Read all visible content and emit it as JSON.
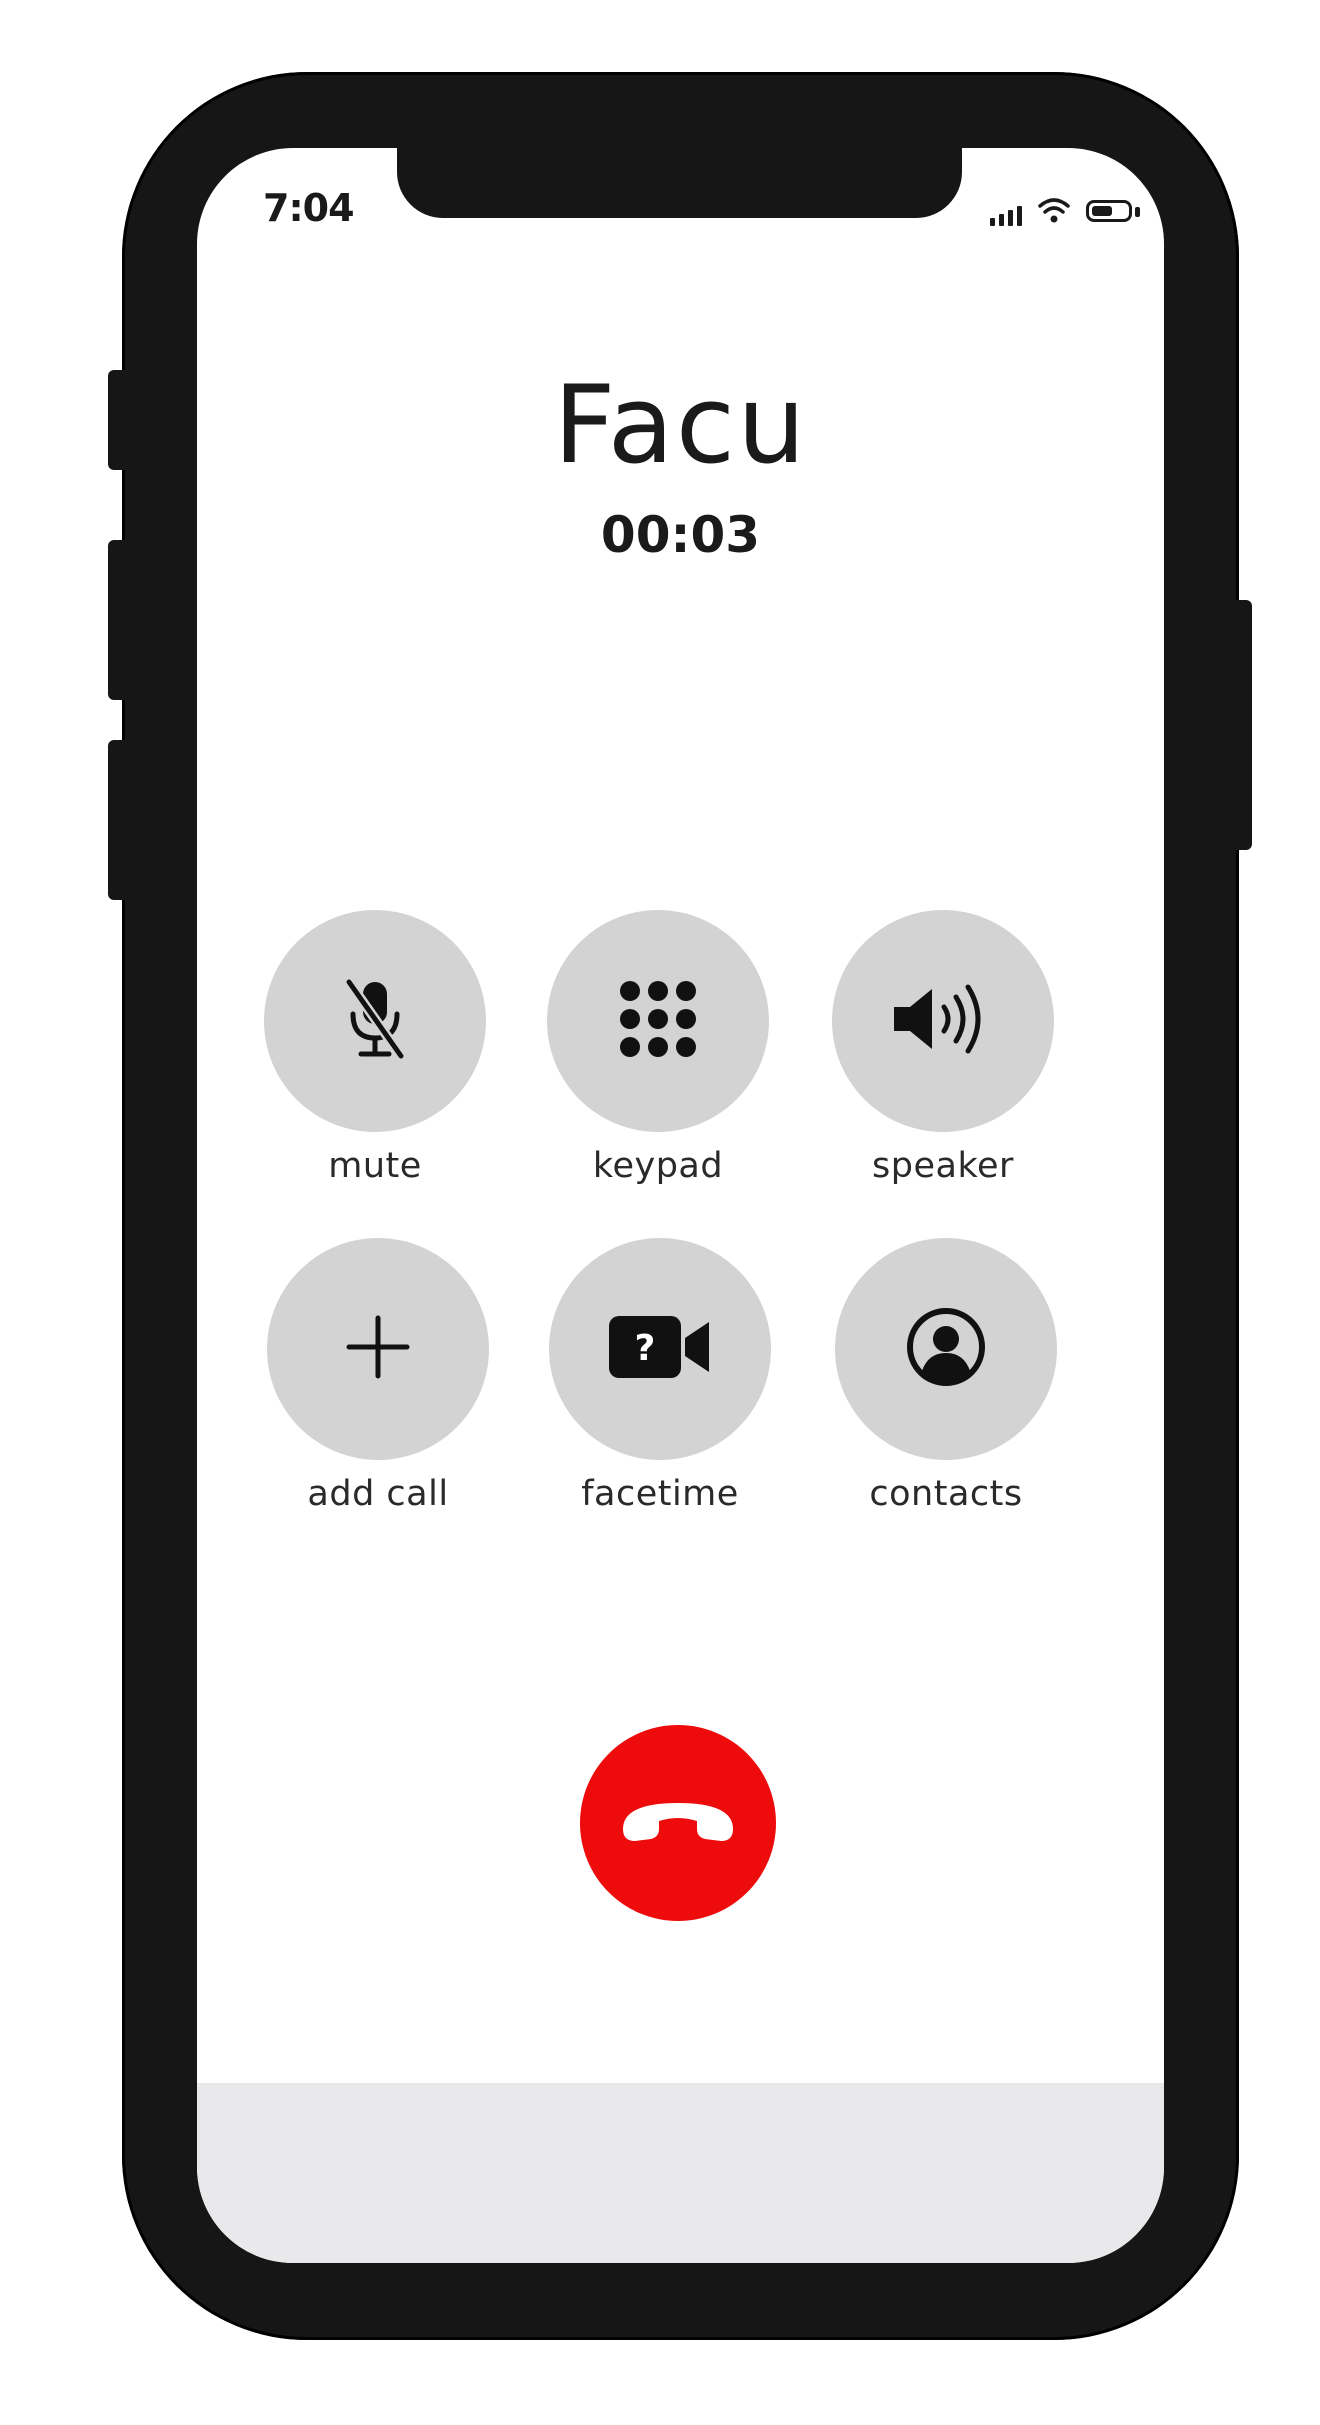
{
  "status_bar": {
    "time": "7:04",
    "signal_icon": "cellular-signal-icon",
    "wifi_icon": "wifi-icon",
    "battery_icon": "battery-icon",
    "battery_level": 0.6
  },
  "call": {
    "caller_name": "Facu",
    "duration": "00:03"
  },
  "controls": [
    {
      "label": "mute",
      "icon": "microphone-slash-icon"
    },
    {
      "label": "keypad",
      "icon": "keypad-grid-icon"
    },
    {
      "label": "speaker",
      "icon": "speaker-icon"
    },
    {
      "label": "add call",
      "icon": "plus-icon"
    },
    {
      "label": "facetime",
      "icon": "video-camera-icon"
    },
    {
      "label": "contacts",
      "icon": "person-circle-icon"
    }
  ],
  "end_call": {
    "icon": "phone-hangup-icon",
    "color": "#ee0b0b"
  },
  "colors": {
    "button_bg": "#d3d3d3",
    "phone_frame": "#161616",
    "bottom_panel": "#e9e9eb"
  }
}
